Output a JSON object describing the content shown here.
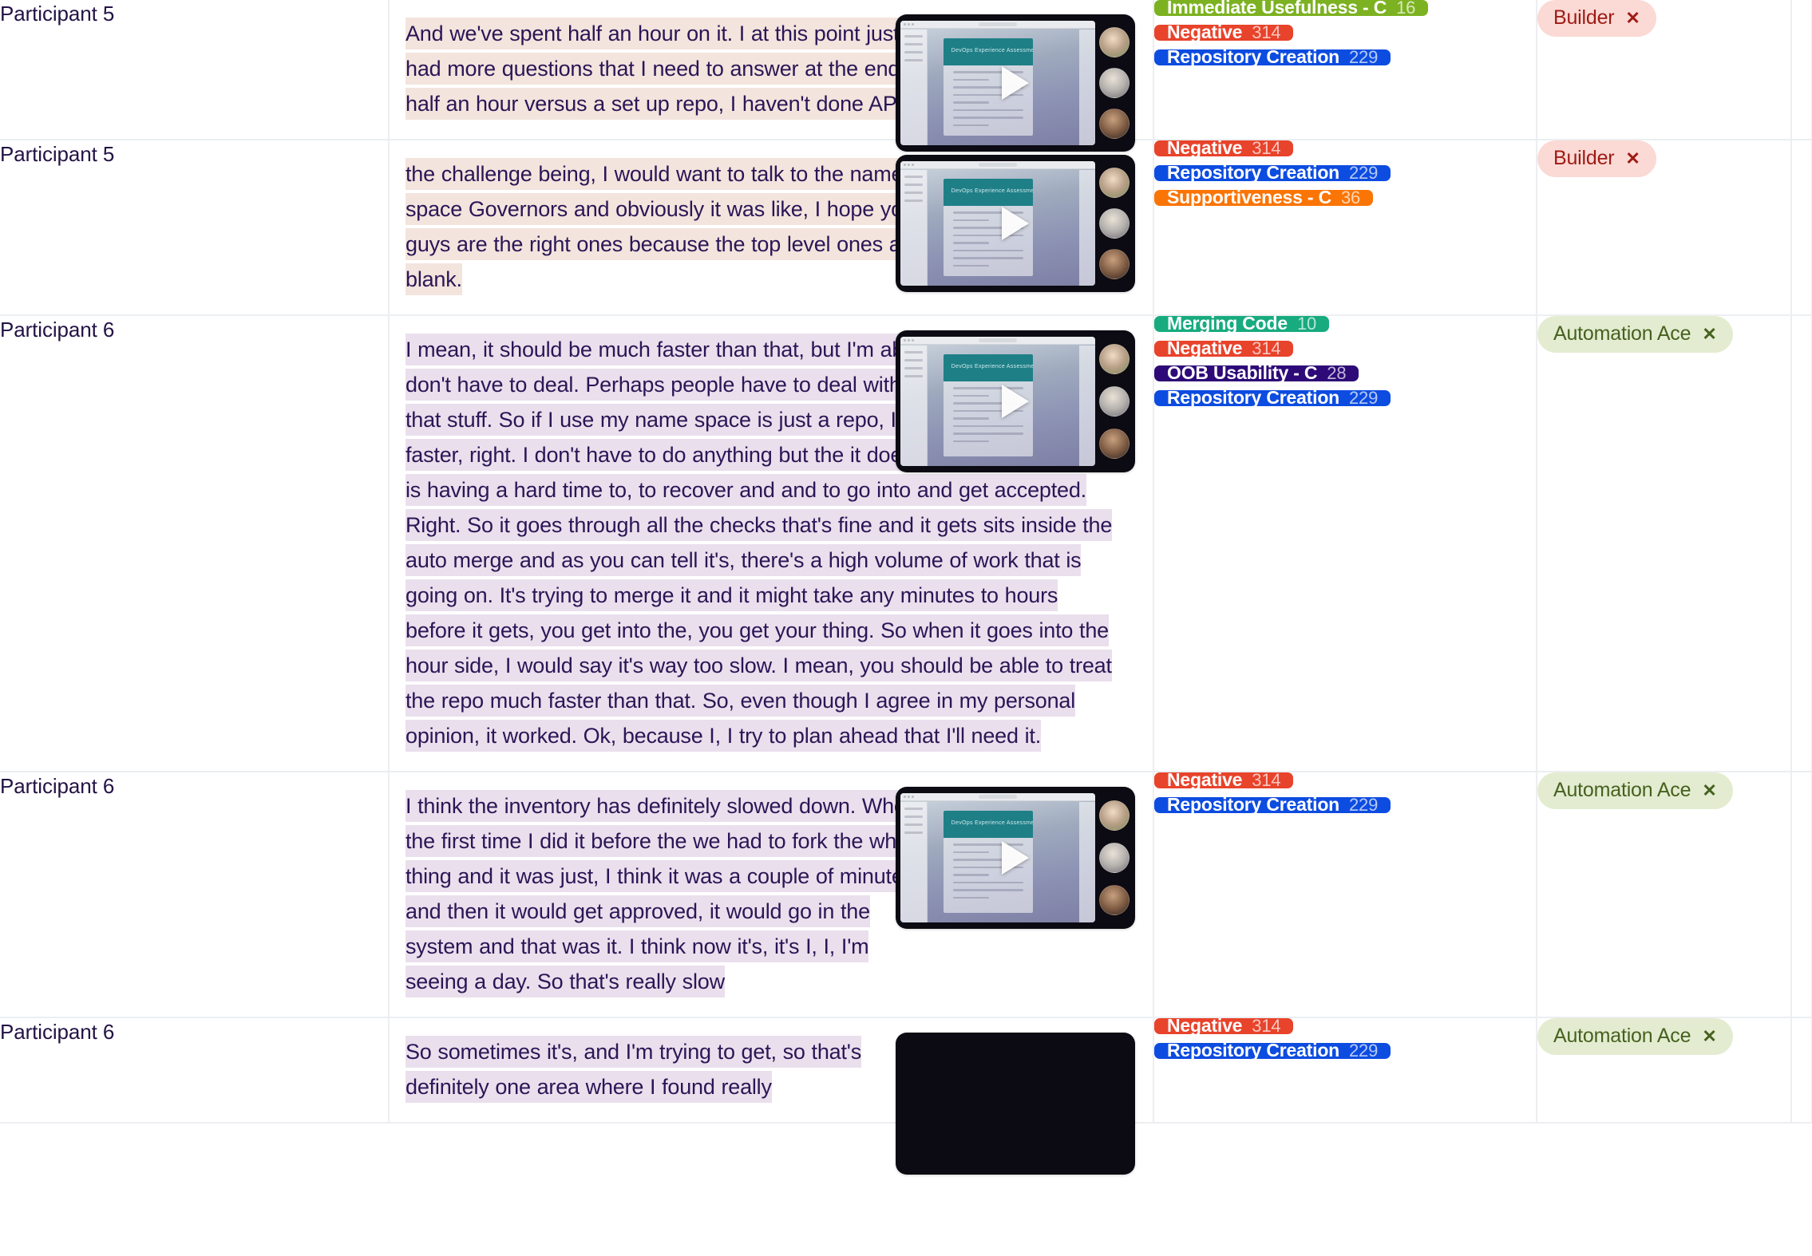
{
  "colors": {
    "text_dark": "#2a1656",
    "participant_text": "#231345",
    "grid_line": "#eceef1",
    "highlight_warm": "#f3e4dd",
    "highlight_cool": "#eadfec",
    "tag_immediate_usefulness": "#7cb221",
    "tag_negative": "#e8432b",
    "tag_repository_creation": "#0d4ce0",
    "tag_supportiveness": "#fa7505",
    "tag_merging_code": "#17ab7f",
    "tag_oob_usability": "#2d0a78",
    "persona_builder_bg": "#fbd9d4",
    "persona_builder_fg": "#9e1b16",
    "persona_ace_bg": "#e3ecd0",
    "persona_ace_fg": "#46611f"
  },
  "icons": {
    "play": "play-icon",
    "remove": "✕"
  },
  "rows": [
    {
      "participant": "Participant 5",
      "quote": "And we've spent half an hour on it. I at this point just had more questions that I need to answer at the end of half an hour versus a set up repo, I haven't done APR,",
      "theme": "warm",
      "tags": [
        {
          "label": "Immediate Usefulness - C",
          "count": "16",
          "color": "#7cb221"
        },
        {
          "label": "Negative",
          "count": "314",
          "color": "#e8432b"
        },
        {
          "label": "Repository Creation",
          "count": "229",
          "color": "#0d4ce0"
        }
      ],
      "personas": [
        {
          "label": "Builder",
          "style": "builder"
        }
      ]
    },
    {
      "participant": "Participant 5",
      "quote": "the challenge being, I would want to talk to the name space Governors and obviously it was like, I hope you guys are the right ones because the top level ones are blank.",
      "theme": "warm",
      "tags": [
        {
          "label": "Negative",
          "count": "314",
          "color": "#e8432b"
        },
        {
          "label": "Repository Creation",
          "count": "229",
          "color": "#0d4ce0"
        },
        {
          "label": "Supportiveness - C",
          "count": "36",
          "color": "#fa7505"
        }
      ],
      "personas": [
        {
          "label": "Builder",
          "style": "builder"
        }
      ]
    },
    {
      "participant": "Participant 6",
      "quote": "I mean, it should be much faster than that, but I'm able to do it because I don't have to deal. Perhaps people have to deal with name space and all that stuff. So if I use my name space is just a repo, I'm the only approver it's faster, right. I don't have to do anything but the it does sit there, the merge is having a hard time to, to recover and and to go into and get accepted. Right. So it goes through all the checks that's fine and it gets sits inside the auto merge and as you can tell it's, there's a high volume of work that is going on. It's trying to merge it and it might take any minutes to hours before it gets, you get into the, you get your thing. So when it goes into the hour side, I would say it's way too slow. I mean, you should be able to treat the repo much faster than that. So, even though I agree in my personal opinion, it worked. Ok, because I, I try to plan ahead that I'll need it.",
      "theme": "cool",
      "tags": [
        {
          "label": "Merging Code",
          "count": "10",
          "color": "#17ab7f"
        },
        {
          "label": "Negative",
          "count": "314",
          "color": "#e8432b"
        },
        {
          "label": "OOB Usability - C",
          "count": "28",
          "color": "#2d0a78"
        },
        {
          "label": "Repository Creation",
          "count": "229",
          "color": "#0d4ce0"
        }
      ],
      "personas": [
        {
          "label": "Automation Ace",
          "style": "ace"
        }
      ]
    },
    {
      "participant": "Participant 6",
      "quote": "I think the inventory has definitely slowed down. When the first time I did it before the we had to fork the whole thing and it was just, I think it was a couple of minutes and then it would get approved, it would go in the system and that was it. I think now it's, it's I, I, I'm seeing a day. So that's really slow",
      "theme": "cool",
      "tags": [
        {
          "label": "Negative",
          "count": "314",
          "color": "#e8432b"
        },
        {
          "label": "Repository Creation",
          "count": "229",
          "color": "#0d4ce0"
        }
      ],
      "personas": [
        {
          "label": "Automation Ace",
          "style": "ace"
        }
      ]
    },
    {
      "participant": "Participant 6",
      "quote": "So sometimes it's, and I'm trying to get, so that's definitely one area where I found really",
      "theme": "cool",
      "tags": [
        {
          "label": "Negative",
          "count": "314",
          "color": "#e8432b"
        },
        {
          "label": "Repository Creation",
          "count": "229",
          "color": "#0d4ce0"
        }
      ],
      "personas": [
        {
          "label": "Automation Ace",
          "style": "ace"
        }
      ]
    }
  ]
}
